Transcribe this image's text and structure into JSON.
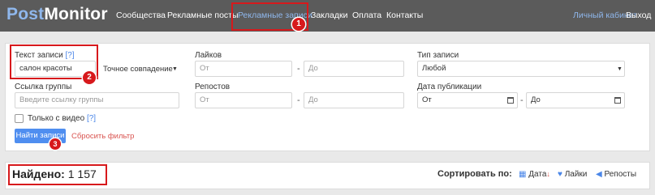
{
  "header": {
    "logo_post": "Post",
    "logo_monitor": "Monitor",
    "nav": [
      "Сообщества",
      "Рекламные посты",
      "Рекламные записи",
      "Закладки",
      "Оплата",
      "Контакты"
    ],
    "account": "Личный кабинет",
    "logout": "Выход"
  },
  "annotations": [
    "1",
    "2",
    "3"
  ],
  "filters": {
    "text_label": "Текст записи",
    "help": "[?]",
    "text_value": "салон красоты",
    "match_mode": "Точное совпадение",
    "likes_label": "Лайков",
    "from_ph": "От",
    "to_ph": "До",
    "reposts_label": "Репостов",
    "type_label": "Тип записи",
    "type_value": "Любой",
    "group_label": "Ссылка группы",
    "group_ph": "Введите ссылку группы",
    "date_label": "Дата публикации",
    "video_label": "Только с видео",
    "search_button": "Найти записи",
    "reset": "Сбросить фильтр",
    "dash": "-"
  },
  "results": {
    "found_label": "Найдено:",
    "found_count": "1 157",
    "sort_label": "Сортировать по:",
    "sort_date": "Дата",
    "sort_likes": "Лайки",
    "sort_reposts": "Репосты"
  }
}
